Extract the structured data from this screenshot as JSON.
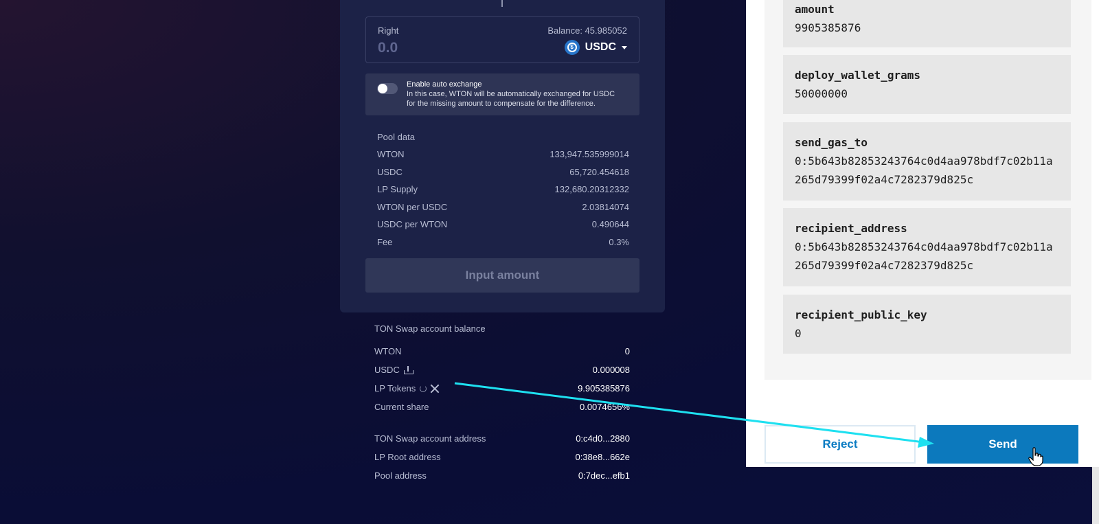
{
  "swap": {
    "right": {
      "label": "Right",
      "balance": "Balance: 45.985052",
      "value_placeholder": "0.0",
      "token": "USDC"
    },
    "auto_exchange": {
      "enabled": false,
      "title": "Enable auto exchange",
      "line1": "In this case, WTON will be automatically exchanged for USDC",
      "line2": "for the missing amount to compensate for the difference."
    },
    "pool": {
      "title": "Pool data",
      "rows": [
        {
          "label": "WTON",
          "value": "133,947.535999014"
        },
        {
          "label": "USDC",
          "value": "65,720.454618"
        },
        {
          "label": "LP Supply",
          "value": "132,680.20312332"
        },
        {
          "label": "WTON per USDC",
          "value": "2.03814074"
        },
        {
          "label": "USDC per WTON",
          "value": "0.490644"
        },
        {
          "label": "Fee",
          "value": "0.3%"
        }
      ]
    },
    "submit_label": "Input amount"
  },
  "account": {
    "title": "TON Swap account balance",
    "wton": {
      "label": "WTON",
      "value": "0"
    },
    "usdc": {
      "label": "USDC",
      "value": "0.000008"
    },
    "lp": {
      "label": "LP Tokens",
      "value": "9.905385876"
    },
    "share": {
      "label": "Current share",
      "value": "0.0074656%"
    },
    "account_address": {
      "label": "TON Swap account address",
      "value": "0:c4d0...2880"
    },
    "lp_root": {
      "label": "LP Root address",
      "value": "0:38e8...662e"
    },
    "pool_address": {
      "label": "Pool address",
      "value": "0:7dec...efb1"
    }
  },
  "popup": {
    "params": [
      {
        "key": "amount",
        "value": "9905385876"
      },
      {
        "key": "deploy_wallet_grams",
        "value": "50000000"
      },
      {
        "key": "send_gas_to",
        "value": "0:5b643b82853243764c0d4aa978bdf7c02b11a265d79399f02a4c7282379d825c"
      },
      {
        "key": "recipient_address",
        "value": "0:5b643b82853243764c0d4aa978bdf7c02b11a265d79399f02a4c7282379d825c"
      },
      {
        "key": "recipient_public_key",
        "value": "0"
      }
    ],
    "reject_label": "Reject",
    "send_label": "Send"
  },
  "colors": {
    "accent": "#0c79bd",
    "annotation_arrow": "#1ee0f0",
    "usdc": "#2775ca"
  },
  "icons": [
    "plus-icon",
    "usdc-icon",
    "chevron-down-icon",
    "upload-icon",
    "refresh-icon",
    "close-icon",
    "hand-cursor-icon"
  ]
}
